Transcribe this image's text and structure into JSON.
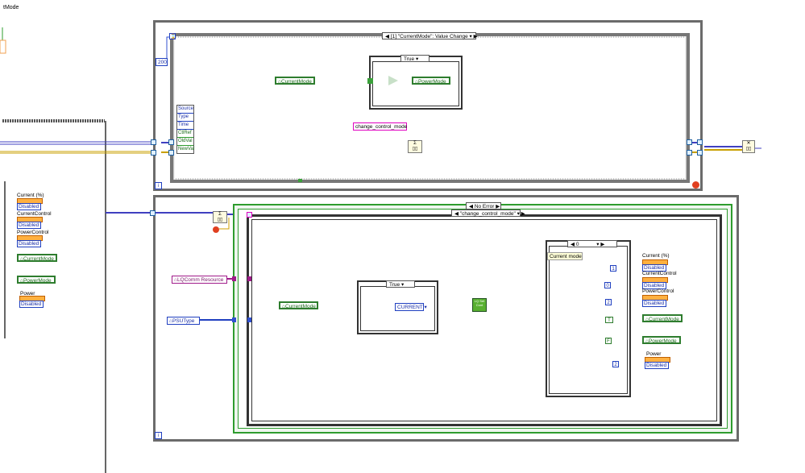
{
  "left_label": "tMode",
  "event_structure": {
    "case_label": "[1] \"CurrentMode\": Value Change",
    "timeout_constant": "200",
    "event_data": [
      "Source",
      "Type",
      "Time",
      "CtlRef",
      "OldVal",
      "NewVal"
    ],
    "true_case_label": "True",
    "current_mode": "CurrentMode",
    "power_mode": "PowerMode",
    "string_constant": "change_control_mode",
    "info_icon": "i"
  },
  "case_structure": {
    "error_case_label": "No Error",
    "selector_label": "\"change_control_mode\"",
    "resource_label": "LQComm Resource",
    "psu_type": "PSUType",
    "current_mode": "CurrentMode",
    "true_case_label": "True",
    "current_enum": "CURRENT",
    "subvi_label": "LQ Set Cont",
    "inner_case_label": "0",
    "inner_case_comment": "Current mode",
    "props": [
      {
        "name": "Current (%)",
        "value": "Disabled",
        "const": "1"
      },
      {
        "name": "CurrentControl",
        "value": "Disabled",
        "const": "0"
      },
      {
        "name": "PowerControl",
        "value": "Disabled",
        "const": "2"
      }
    ],
    "current_mode_out": "CurrentMode",
    "current_mode_const": "T",
    "power_mode_out": "PowerMode",
    "power_mode_const": "F",
    "power_name": "Power",
    "power_value": "Disabled",
    "power_const": "2",
    "info_icon": "i"
  },
  "left_panel": {
    "props": [
      {
        "name": "Current (%)",
        "value": "Disabled"
      },
      {
        "name": "CurrentControl",
        "value": "Disabled"
      },
      {
        "name": "PowerControl",
        "value": "Disabled"
      }
    ],
    "current_mode": "CurrentMode",
    "power_mode": "PowerMode",
    "power_name": "Power",
    "power_value": "Disabled"
  }
}
